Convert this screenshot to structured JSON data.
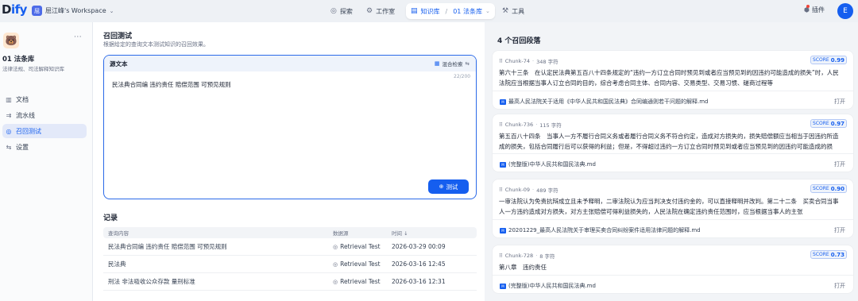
{
  "app": {
    "logo_prefix": "D",
    "logo_suffix": "ify",
    "workspace_initial": "屈",
    "workspace_name": "屈江峰's Workspace"
  },
  "nav": {
    "explore": "探索",
    "studio": "工作室",
    "knowledge": "知识库",
    "current_kb": "01 法条库",
    "tools": "工具",
    "plugins": "插件",
    "user_initial": "E"
  },
  "sidebar": {
    "kb_name": "01 法条库",
    "kb_desc": "法律法规、司法解释知识库",
    "items": [
      {
        "label": "文档"
      },
      {
        "label": "流水线"
      },
      {
        "label": "召回测试"
      },
      {
        "label": "设置"
      }
    ]
  },
  "retrieval": {
    "title": "召回测试",
    "subtitle": "根据给定的查询文本测试知识的召回效果。",
    "source_label": "源文本",
    "mode_label": "混合检索",
    "char_count": "22/200",
    "query_text": "民法典合同编 违约责任 赔偿范围 可预见规则",
    "test_button": "测试"
  },
  "records": {
    "title": "记录",
    "headers": {
      "query": "查询内容",
      "source": "数据源",
      "time": "时间"
    },
    "rows": [
      {
        "query": "民法典合同编 违约责任 赔偿范围 可预见规则",
        "source": "Retrieval Test",
        "time": "2026-03-29 00:09"
      },
      {
        "query": "民法典",
        "source": "Retrieval Test",
        "time": "2026-03-16 12:45"
      },
      {
        "query": "刑法 非法吸收公众存款 量刑标准",
        "source": "Retrieval Test",
        "time": "2026-03-16 12:31"
      }
    ]
  },
  "results": {
    "title": "4 个召回段落",
    "score_label": "SCORE",
    "open_label": "打开",
    "chunks": [
      {
        "chunk_id": "Chunk-74",
        "chars": "348 字符",
        "score": "0.99",
        "text": "第六十三条　在认定民法典第五百八十四条规定的“违约一方订立合同时预见到或者应当预见到的因违约可能造成的损失”时，人民法院应当根据当事人订立合同的目的，综合考虑合同主体、合同内容、交易类型、交易习惯、磋商过程等",
        "file": "最高人民法院关于适用《中华人民共和国民法典》合同编通则若干问题的解释.md"
      },
      {
        "chunk_id": "Chunk-736",
        "chars": "115 字符",
        "score": "0.97",
        "text": "第五百八十四条　当事人一方不履行合同义务或者履行合同义务不符合约定，造成对方损失的，损失赔偿额应当相当于因违约所造成的损失，包括合同履行后可以获得的利益；但是，不得超过违约一方订立合同时预见到或者应当预见到的因违约可能造成的损失。",
        "file": "(完整版)中华人民共和国民法典.md"
      },
      {
        "chunk_id": "Chunk-09",
        "chars": "489 字符",
        "score": "0.90",
        "text": "一审法院认为免责抗辩成立且未予释明，二审法院认为应当判决支付违约金的，可以直接释明并改判。第二十二条　买卖合同当事人一方违约造成对方损失，对方主张赔偿可得利益损失的，人民法院在确定违约责任范围时，应当根据当事人的主张",
        "file": "20201229_最高人民法院关于审理买卖合同纠纷案件适用法律问题的解释.md"
      },
      {
        "chunk_id": "Chunk-728",
        "chars": "8 字符",
        "score": "0.73",
        "text": "第八章　违约责任",
        "file": "(完整版)中华人民共和国民法典.md"
      }
    ]
  }
}
